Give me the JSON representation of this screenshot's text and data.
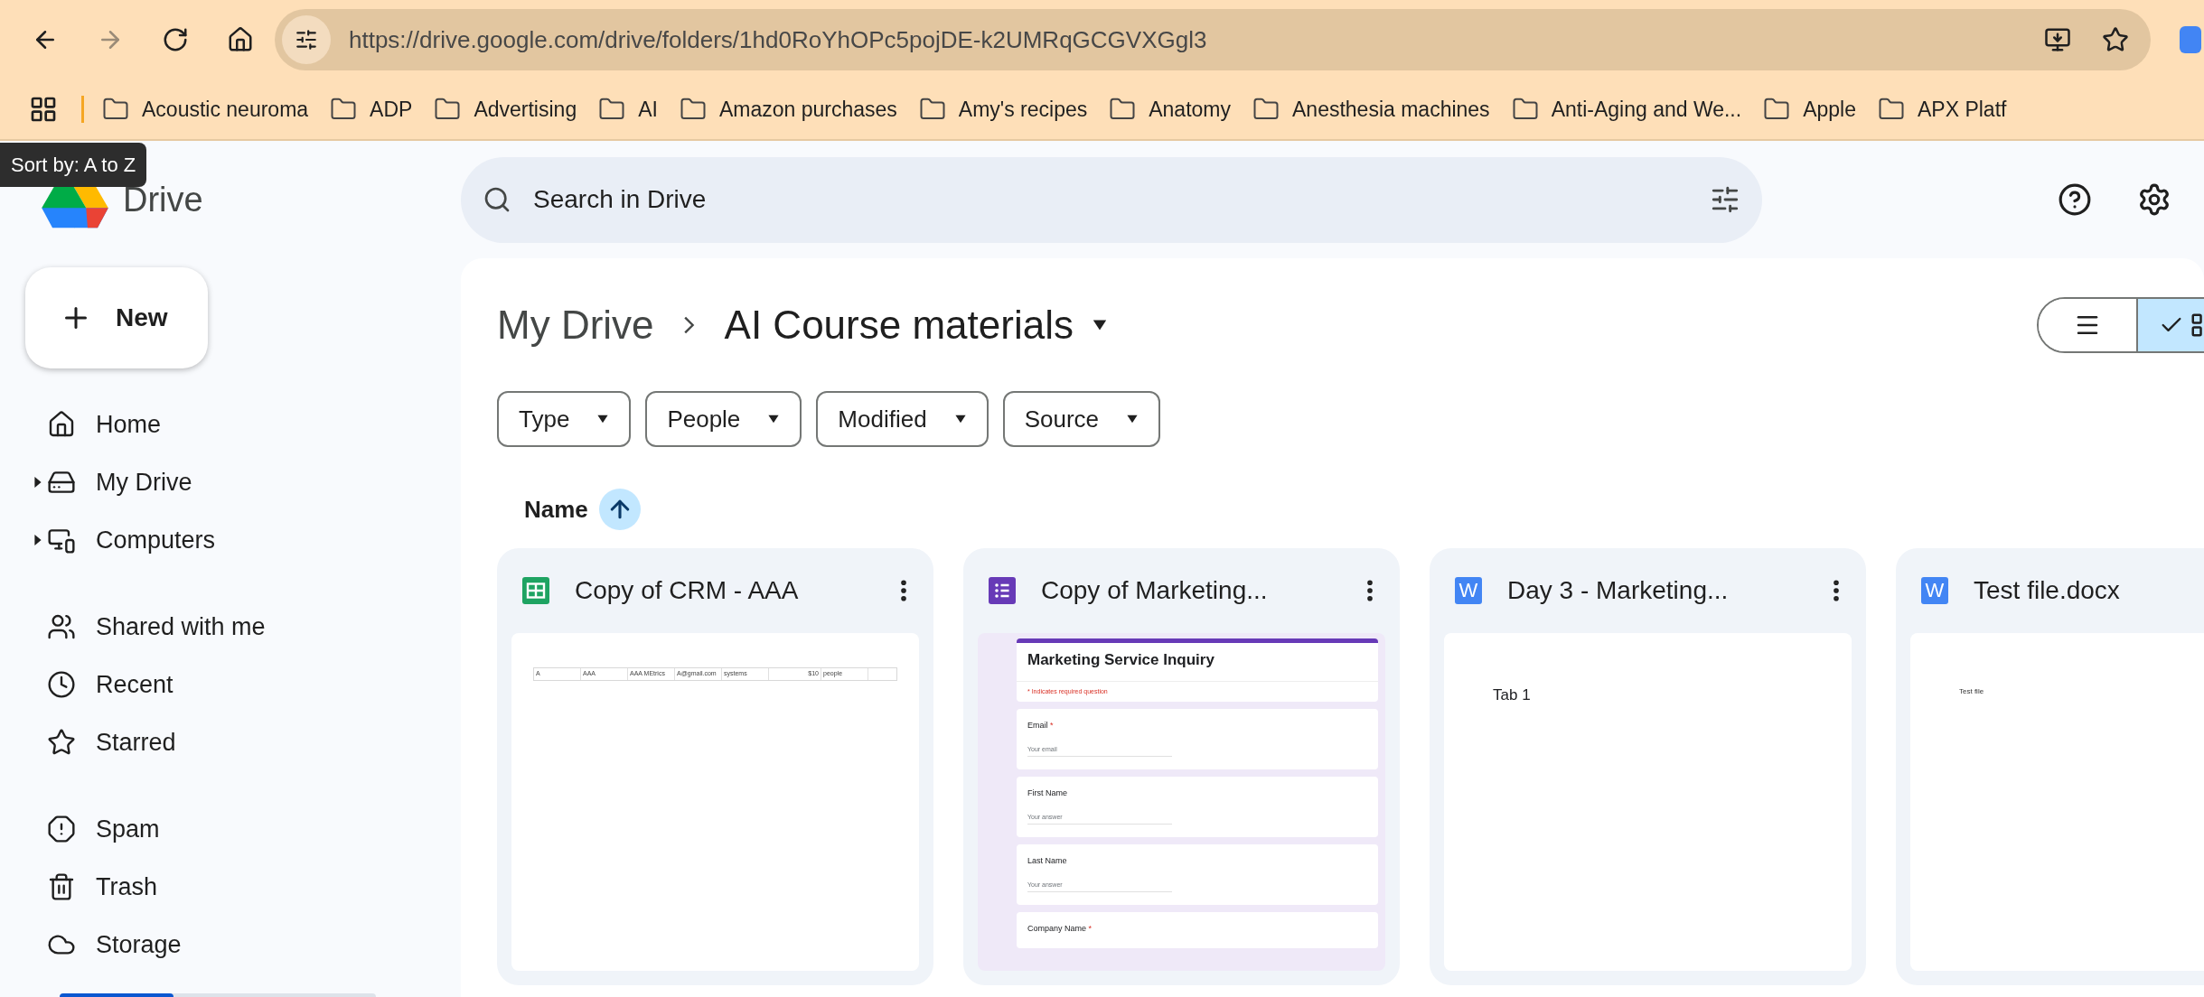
{
  "browser": {
    "url": "https://drive.google.com/drive/folders/1hd0RoYhOPc5pojDE-k2UMRqGCGVXGgl3",
    "nav": [
      {
        "disabled": false
      },
      {
        "disabled": true
      },
      {
        "disabled": false
      },
      {
        "disabled": false
      }
    ],
    "bookmarks": [
      "Acoustic neuroma",
      "ADP",
      "Advertising",
      "AI",
      "Amazon purchases",
      "Amy's recipes",
      "Anatomy",
      "Anesthesia machines",
      "Anti-Aging and We...",
      "Apple",
      "APX Platf"
    ]
  },
  "tooltip": "Sort by: A to Z",
  "app": {
    "name": "Drive"
  },
  "search": {
    "placeholder": "Search in Drive"
  },
  "new_button": "New",
  "sidebar": {
    "groups": [
      {
        "items": [
          {
            "label": "Home",
            "expandable": false
          },
          {
            "label": "My Drive",
            "expandable": true
          },
          {
            "label": "Computers",
            "expandable": true
          }
        ]
      },
      {
        "items": [
          {
            "label": "Shared with me",
            "expandable": false
          },
          {
            "label": "Recent",
            "expandable": false
          },
          {
            "label": "Starred",
            "expandable": false
          }
        ]
      },
      {
        "items": [
          {
            "label": "Spam",
            "expandable": false
          },
          {
            "label": "Trash",
            "expandable": false
          },
          {
            "label": "Storage",
            "expandable": false
          }
        ]
      }
    ],
    "storage": {
      "level": 0.36
    }
  },
  "breadcrumb": {
    "items": [
      "My Drive"
    ],
    "current": "AI Course materials"
  },
  "view_toggle": [
    {
      "selected": false
    },
    {
      "selected": true
    }
  ],
  "filters": [
    "Type",
    "People",
    "Modified",
    "Source"
  ],
  "sort": {
    "label": "Name",
    "ascending": true
  },
  "files": [
    {
      "name": "Copy of CRM - AAA",
      "kind": "sheet",
      "preview": {
        "cells": [
          "A",
          "AAA",
          "AAA MEtrics",
          "A@gmail.com",
          "systems",
          "$10",
          "people"
        ]
      }
    },
    {
      "name": "Copy of Marketing...",
      "kind": "form",
      "preview": {
        "title": "Marketing Service Inquiry",
        "note": "* Indicates required question",
        "questions": [
          {
            "label": "Email",
            "mark": "*",
            "hint": "Your email"
          },
          {
            "label": "First Name",
            "hint": "Your answer"
          },
          {
            "label": "Last Name",
            "hint": "Your answer"
          },
          {
            "label": "Company Name",
            "mark": "*"
          }
        ]
      }
    },
    {
      "name": "Day 3 - Marketing...",
      "kind": "doc",
      "icon_letter": "W",
      "preview": {
        "text": "Tab 1"
      }
    },
    {
      "name": "Test file.docx",
      "kind": "docx",
      "icon_letter": "W",
      "preview": {
        "text": "Test file"
      }
    }
  ]
}
